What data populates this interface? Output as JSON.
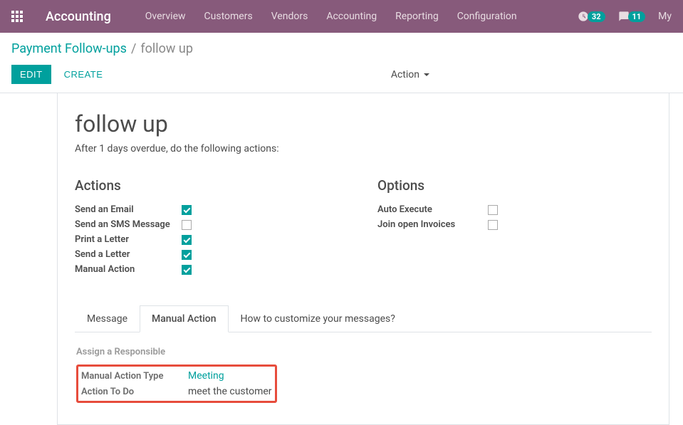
{
  "navbar": {
    "brand": "Accounting",
    "menu": [
      "Overview",
      "Customers",
      "Vendors",
      "Accounting",
      "Reporting",
      "Configuration"
    ],
    "activity_count": "32",
    "messages_count": "11",
    "user": "My"
  },
  "breadcrumb": {
    "parent": "Payment Follow-ups",
    "current": "follow up"
  },
  "buttons": {
    "edit": "EDIT",
    "create": "CREATE",
    "action": "Action"
  },
  "form": {
    "title": "follow up",
    "subtitle": "After 1 days overdue, do the following actions:"
  },
  "actions_section": {
    "title": "Actions",
    "items": [
      {
        "label": "Send an Email",
        "checked": true
      },
      {
        "label": "Send an SMS Message",
        "checked": false
      },
      {
        "label": "Print a Letter",
        "checked": true
      },
      {
        "label": "Send a Letter",
        "checked": true
      },
      {
        "label": "Manual Action",
        "checked": true
      }
    ]
  },
  "options_section": {
    "title": "Options",
    "items": [
      {
        "label": "Auto Execute",
        "checked": false
      },
      {
        "label": "Join open Invoices",
        "checked": false
      }
    ]
  },
  "tabs": {
    "items": [
      "Message",
      "Manual Action",
      "How to customize your messages?"
    ],
    "active": 1
  },
  "manual_action": {
    "section": "Assign a Responsible",
    "type_label": "Manual Action Type",
    "type_value": "Meeting",
    "todo_label": "Action To Do",
    "todo_value": "meet the customer"
  }
}
